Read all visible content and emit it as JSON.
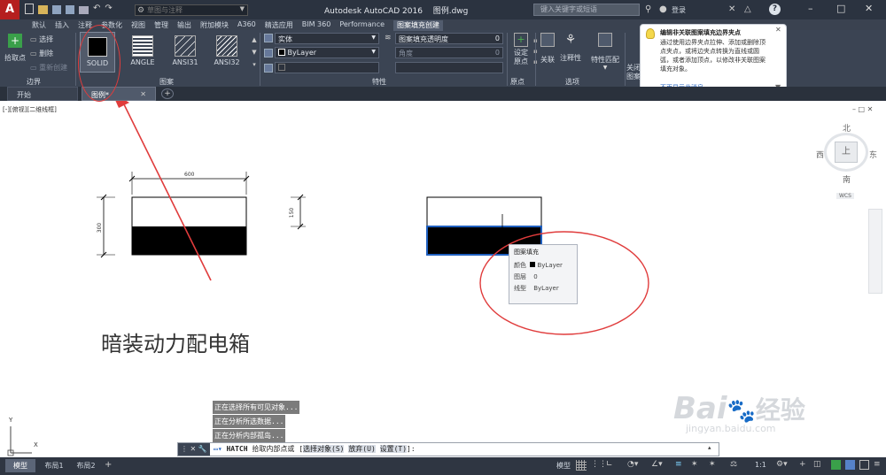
{
  "titlebar": {
    "quick_access_hint": "草图与注释",
    "app_title": "Autodesk AutoCAD 2016",
    "file_name": "图例.dwg",
    "search_placeholder": "键入关键字或短语",
    "login": "登录"
  },
  "ribbon_tabs": [
    "默认",
    "插入",
    "注释",
    "参数化",
    "视图",
    "管理",
    "输出",
    "附加模块",
    "A360",
    "精选应用",
    "BIM 360",
    "Performance",
    "图案填充创建"
  ],
  "ribbon": {
    "boundary": {
      "pick_point": "拾取点",
      "select": "选择",
      "remove": "删除",
      "recreate": "重新创建",
      "panel": "边界"
    },
    "patterns": [
      "SOLID",
      "ANGLE",
      "ANSI31",
      "ANSI32"
    ],
    "pattern_panel": "图案",
    "props": {
      "type": "实体",
      "color": "ByLayer",
      "transparency_label": "图案填充透明度",
      "transparency_value": "0",
      "angle_label": "角度",
      "angle_value": "0",
      "panel": "特性"
    },
    "origin": {
      "set_origin": "设定\n原点",
      "panel": "原点"
    },
    "options": {
      "associative": "关联",
      "annotative": "注释性",
      "match": "特性匹配",
      "panel": "选项"
    },
    "close_stub": "关闭\n图案填充创建",
    "close_panel": "关闭"
  },
  "tooltip_balloon": {
    "title": "编辑非关联图案填充边界夹点",
    "body": "通过使用边界夹点拉伸、添加或删除顶点夹点，或将边夹点转换为直线或圆弧，或者添加顶点，以修改非关联图案填充对象。",
    "link": "不再显示此消息"
  },
  "doc_tabs": [
    "开始",
    "图例*"
  ],
  "viewport_label": "[-][俯视][二维线框]",
  "viewcube": {
    "north": "北",
    "south": "南",
    "east": "东",
    "west": "西",
    "top": "上",
    "wcs": "WCS"
  },
  "drawing": {
    "dim_width": "600",
    "dim_height": "300",
    "dim_half": "150",
    "caption": "暗装动力配电箱"
  },
  "hover_tip": {
    "title": "图案填充",
    "rows": [
      {
        "k": "颜色",
        "v": "ByLayer"
      },
      {
        "k": "图层",
        "v": "0"
      },
      {
        "k": "线型",
        "v": "ByLayer"
      }
    ]
  },
  "command_history": [
    "正在选择所有可见对象...",
    "正在分析所选数据...",
    "正在分析内部孤岛..."
  ],
  "command_line": {
    "prefix": "HATCH",
    "text": "拾取内部点或",
    "opt1": "选择对象(S)",
    "opt2": "放弃(U)",
    "opt3": "设置(T)",
    "suffix": "]:"
  },
  "layout_tabs": [
    "模型",
    "布局1",
    "布局2"
  ],
  "status": {
    "model": "模型",
    "scale": "1:1"
  },
  "watermark": {
    "brand": "Bai",
    "brand2": "经验",
    "url": "jingyan.baidu.com"
  },
  "colors": {
    "accent": "#e03c3c",
    "ribbon": "#3b4453",
    "selection_blue": "#1f5fbf"
  }
}
